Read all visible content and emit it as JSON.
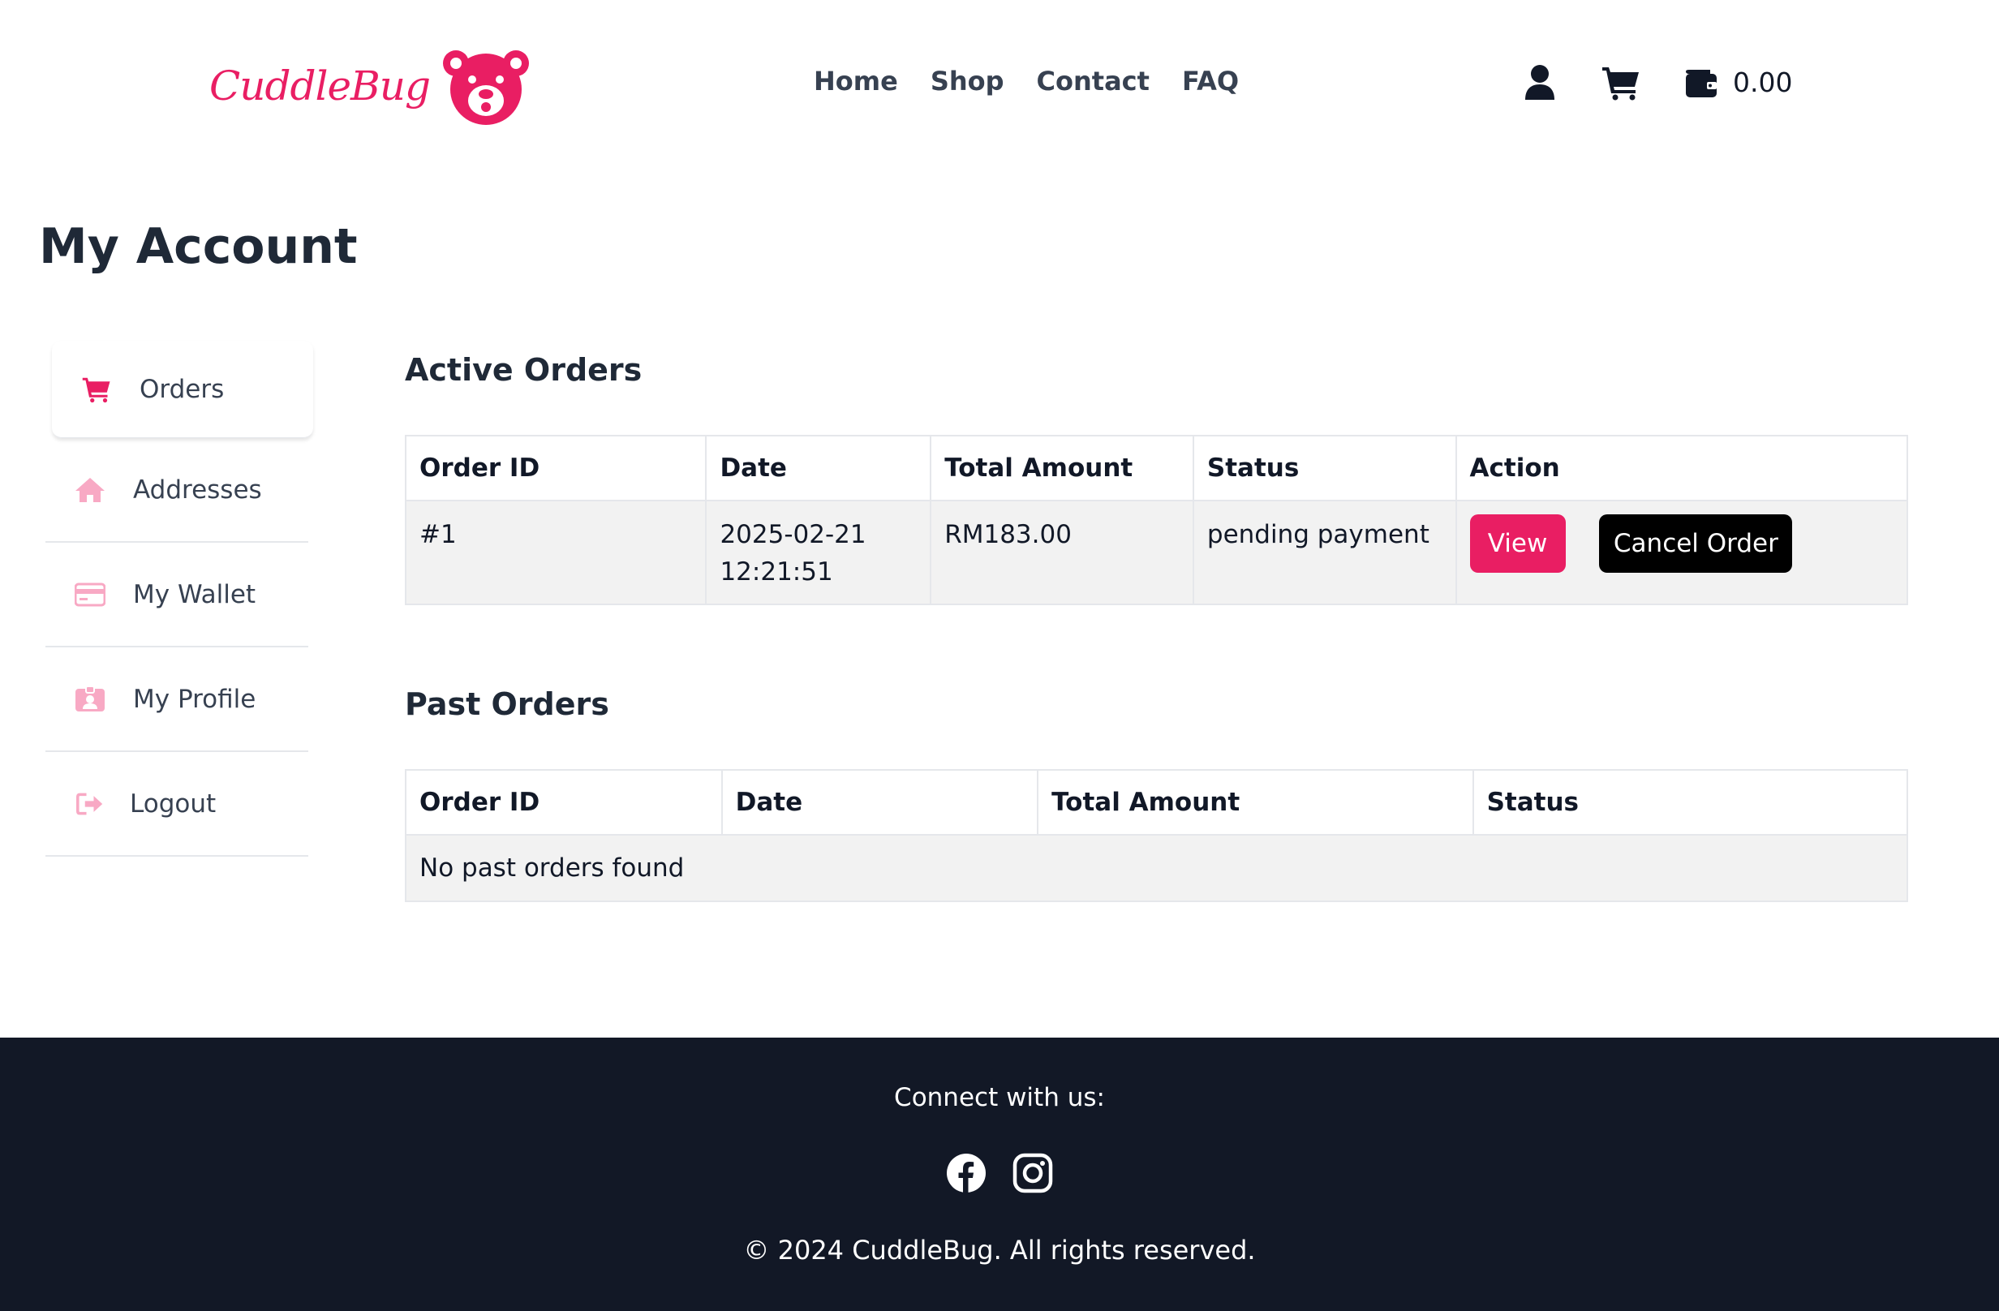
{
  "brand": {
    "name": "CuddleBug",
    "accent_color": "#e91e63"
  },
  "nav": {
    "items": [
      "Home",
      "Shop",
      "Contact",
      "FAQ"
    ]
  },
  "header": {
    "wallet_amount": "0.00",
    "icons": [
      "user-icon",
      "cart-icon",
      "wallet-icon"
    ]
  },
  "page": {
    "title": "My Account"
  },
  "sidebar": {
    "items": [
      {
        "label": "Orders",
        "icon": "cart-icon",
        "active": true
      },
      {
        "label": "Addresses",
        "icon": "home-icon",
        "active": false
      },
      {
        "label": "My Wallet",
        "icon": "credit-card-icon",
        "active": false
      },
      {
        "label": "My Profile",
        "icon": "id-badge-icon",
        "active": false
      },
      {
        "label": "Logout",
        "icon": "sign-out-icon",
        "active": false
      }
    ]
  },
  "active_orders": {
    "title": "Active Orders",
    "columns": [
      "Order ID",
      "Date",
      "Total Amount",
      "Status",
      "Action"
    ],
    "rows": [
      {
        "order_id": "#1",
        "date_line1": "2025-02-21",
        "date_line2": "12:21:51",
        "total": "RM183.00",
        "status": "pending payment",
        "view_label": "View",
        "cancel_label": "Cancel Order"
      }
    ]
  },
  "past_orders": {
    "title": "Past Orders",
    "columns": [
      "Order ID",
      "Date",
      "Total Amount",
      "Status"
    ],
    "empty_message": "No past orders found"
  },
  "footer": {
    "connect": "Connect with us:",
    "social": [
      "facebook-icon",
      "instagram-icon"
    ],
    "copyright": "© 2024 CuddleBug. All rights reserved.",
    "background": "#121826"
  }
}
